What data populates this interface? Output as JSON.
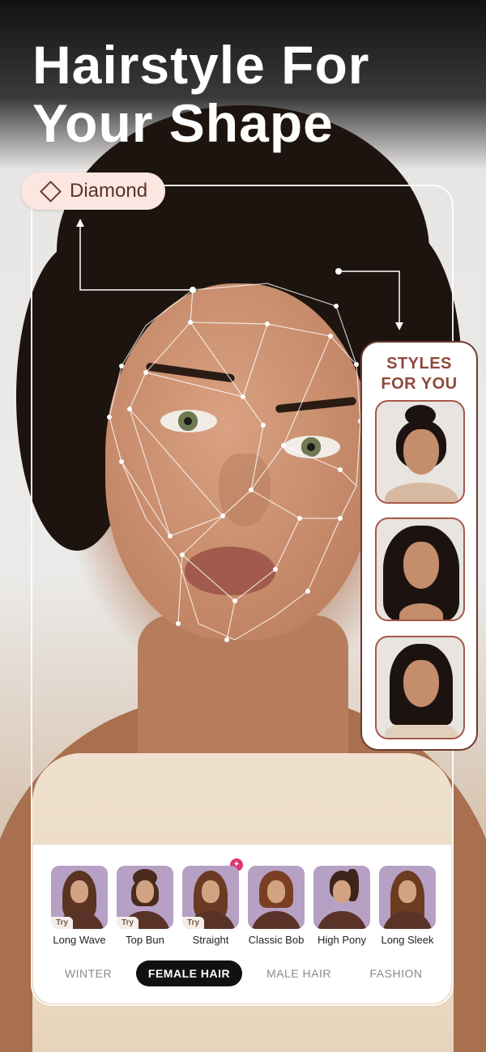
{
  "headline": {
    "line1": "Hairstyle For",
    "line2": "Your Shape"
  },
  "face_shape_chip": {
    "icon": "diamond-outline-icon",
    "label": "Diamond"
  },
  "styles_for_you": {
    "title_line1": "STYLES",
    "title_line2": "FOR YOU",
    "cards": [
      "top-bun-portrait",
      "long-wavy-portrait",
      "straight-bob-portrait"
    ]
  },
  "hairstyles": [
    {
      "label": "Long Wave",
      "try": "Try",
      "hair_color": "#5b3322"
    },
    {
      "label": "Top Bun",
      "try": "Try",
      "hair_color": "#4a2a1c"
    },
    {
      "label": "Straight",
      "try": "Try",
      "hair_color": "#6a3a22"
    },
    {
      "label": "Classic Bob",
      "try": "",
      "hair_color": "#7a3f22"
    },
    {
      "label": "High Pony",
      "try": "",
      "hair_color": "#3e241a"
    },
    {
      "label": "Long Sleek",
      "try": "",
      "hair_color": "#6e3a20"
    }
  ],
  "new_badge_icon": "sparkle-icon",
  "tabs": [
    {
      "label": "WINTER",
      "active": false
    },
    {
      "label": "FEMALE HAIR",
      "active": true
    },
    {
      "label": "MALE HAIR",
      "active": false
    },
    {
      "label": "FASHION",
      "active": false
    }
  ],
  "colors": {
    "accent_dark": "#111111",
    "chip_bg": "#fbe6e1",
    "brand_brown": "#8e4a3c",
    "thumb_bg": "#b6a0c4",
    "badge": "#e03470"
  }
}
